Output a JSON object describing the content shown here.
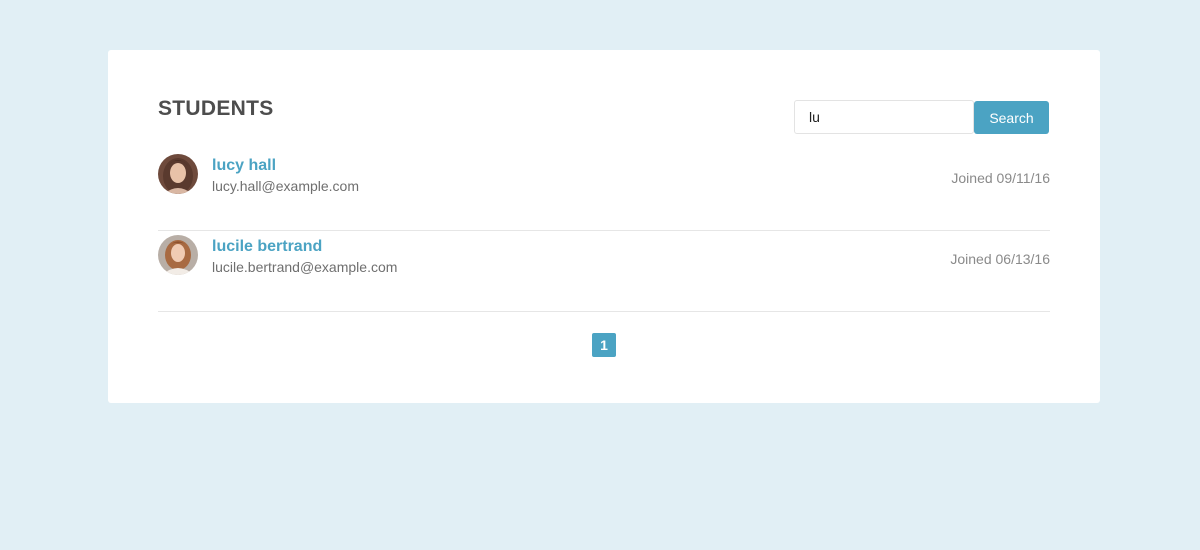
{
  "header": {
    "title": "STUDENTS"
  },
  "search": {
    "value": "lu",
    "button_label": "Search"
  },
  "students": [
    {
      "name": "lucy hall",
      "email": "lucy.hall@example.com",
      "joined": "Joined 09/11/16"
    },
    {
      "name": "lucile bertrand",
      "email": "lucile.bertrand@example.com",
      "joined": "Joined 06/13/16"
    }
  ],
  "pagination": {
    "current_page": "1"
  },
  "colors": {
    "background": "#e1eff5",
    "accent": "#4ba3c3",
    "title": "#4d4d4d"
  }
}
